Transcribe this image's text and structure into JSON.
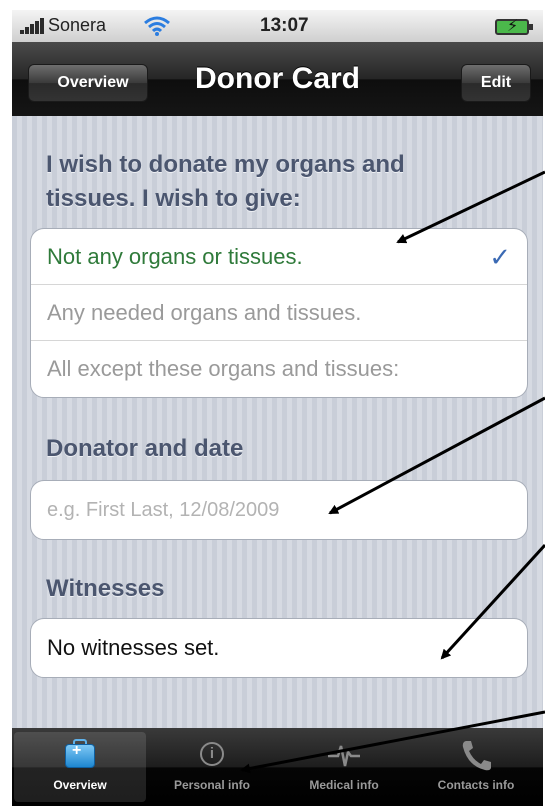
{
  "status_bar": {
    "carrier": "Sonera",
    "time": "13:07"
  },
  "nav_bar": {
    "back_label": "Overview",
    "title": "Donor Card",
    "edit_label": "Edit"
  },
  "donation": {
    "header_line1": "I wish to donate my organs and",
    "header_line2": "tissues. I wish to give:",
    "options": [
      {
        "label": "Not any organs or tissues.",
        "selected": true
      },
      {
        "label": "Any needed organs and tissues.",
        "selected": false
      },
      {
        "label": "All except these organs and tissues:",
        "selected": false
      }
    ],
    "checkmark": "✓"
  },
  "donator": {
    "header": "Donator and date",
    "placeholder": "e.g. First Last, 12/08/2009"
  },
  "witnesses": {
    "header": "Witnesses",
    "value": "No witnesses set."
  },
  "tab_bar": {
    "tabs": [
      {
        "label": "Overview",
        "icon": "first-aid-kit-icon",
        "active": true
      },
      {
        "label": "Personal info",
        "icon": "info-icon",
        "active": false
      },
      {
        "label": "Medical info",
        "icon": "heartbeat-icon",
        "active": false
      },
      {
        "label": "Contacts info",
        "icon": "phone-icon",
        "active": false
      }
    ]
  },
  "colors": {
    "selected_text": "#2f7a3a",
    "checkmark": "#3b6ab4",
    "section_header": "#4b566f"
  }
}
